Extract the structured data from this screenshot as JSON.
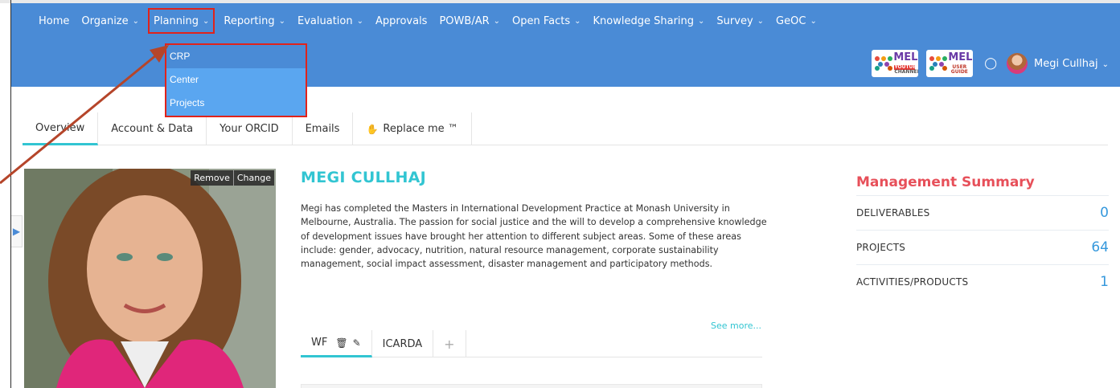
{
  "nav": {
    "items": [
      {
        "label": "Home",
        "chevron": false
      },
      {
        "label": "Organize",
        "chevron": true
      },
      {
        "label": "Planning",
        "chevron": true
      },
      {
        "label": "Reporting",
        "chevron": true
      },
      {
        "label": "Evaluation",
        "chevron": true
      },
      {
        "label": "Approvals",
        "chevron": false
      },
      {
        "label": "POWB/AR",
        "chevron": true
      },
      {
        "label": "Open Facts",
        "chevron": true
      },
      {
        "label": "Knowledge Sharing",
        "chevron": true
      },
      {
        "label": "Survey",
        "chevron": true
      },
      {
        "label": "GeOC",
        "chevron": true
      }
    ],
    "dropdown": [
      "CRP",
      "Center",
      "Projects"
    ]
  },
  "header": {
    "mel_youtube": {
      "title": "MEL",
      "sub1": "YOUTUBE",
      "sub2": "CHANNEL"
    },
    "mel_guide": {
      "title": "MEL",
      "sub1": "USER",
      "sub2": "GUIDE"
    },
    "user_name": "Megi Cullhaj"
  },
  "tabs": [
    "Overview",
    "Account & Data",
    "Your ORCID",
    "Emails",
    "Replace me ™"
  ],
  "photo": {
    "remove": "Remove",
    "change": "Change"
  },
  "profile": {
    "name": "MEGI CULLHAJ",
    "bio": "Megi has completed the Masters in International Development Practice at Monash University in Melbourne, Australia. The passion for social justice and the will to develop a comprehensive knowledge of development issues have brought her attention to different subject areas. Some of these areas include: gender, advocacy, nutrition, natural resource management, corporate sustainability management, social impact assessment, disaster management and participatory methods.",
    "see_more": "See more..."
  },
  "subtabs": {
    "first": "WF",
    "second": "ICARDA",
    "plus": "+"
  },
  "summary": {
    "title": "Management Summary",
    "rows": [
      {
        "label": "DELIVERABLES",
        "value": "0"
      },
      {
        "label": "PROJECTS",
        "value": "64"
      },
      {
        "label": "ACTIVITIES/PRODUCTS",
        "value": "1"
      }
    ]
  },
  "colors": {
    "header": "#4a8bd6",
    "accent": "#32c5d2",
    "summary_title": "#e7505a",
    "highlight": "#e0231b"
  }
}
